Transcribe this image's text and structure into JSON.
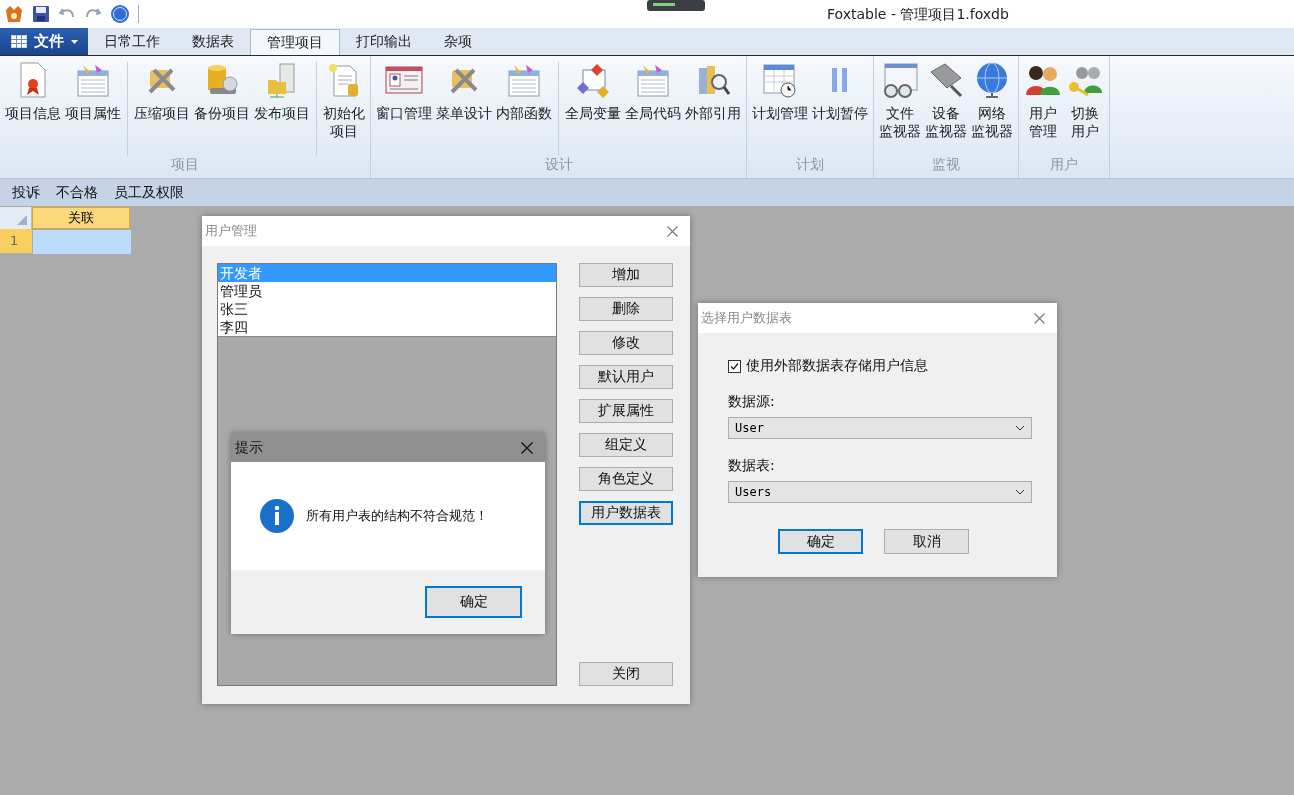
{
  "window": {
    "title": "Foxtable - 管理项目1.foxdb"
  },
  "file_button": {
    "label": "文件"
  },
  "ribbon_tabs": [
    {
      "label": "日常工作",
      "selected": false
    },
    {
      "label": "数据表",
      "selected": false
    },
    {
      "label": "管理项目",
      "selected": true
    },
    {
      "label": "打印输出",
      "selected": false
    },
    {
      "label": "杂项",
      "selected": false
    }
  ],
  "ribbon_groups": [
    {
      "label": "项目",
      "items": [
        {
          "lines": [
            "项目信息"
          ],
          "divider_before": false
        },
        {
          "lines": [
            "项目属性"
          ],
          "divider_before": false
        },
        {
          "lines": [
            "压缩项目"
          ],
          "divider_before": true
        },
        {
          "lines": [
            "备份项目"
          ],
          "divider_before": false
        },
        {
          "lines": [
            "发布项目"
          ],
          "divider_before": false
        },
        {
          "lines": [
            "初始化",
            "项目"
          ],
          "divider_before": true
        }
      ]
    },
    {
      "label": "设计",
      "items": [
        {
          "lines": [
            "窗口管理"
          ],
          "divider_before": false
        },
        {
          "lines": [
            "菜单设计"
          ],
          "divider_before": false
        },
        {
          "lines": [
            "内部函数"
          ],
          "divider_before": false
        },
        {
          "lines": [
            "全局变量"
          ],
          "divider_before": true
        },
        {
          "lines": [
            "全局代码"
          ],
          "divider_before": false
        },
        {
          "lines": [
            "外部引用"
          ],
          "divider_before": false
        }
      ]
    },
    {
      "label": "计划",
      "items": [
        {
          "lines": [
            "计划管理"
          ],
          "divider_before": false
        },
        {
          "lines": [
            "计划暂停"
          ],
          "divider_before": false
        }
      ]
    },
    {
      "label": "监视",
      "items": [
        {
          "lines": [
            "文件",
            "监视器"
          ],
          "divider_before": false
        },
        {
          "lines": [
            "设备",
            "监视器"
          ],
          "divider_before": false
        },
        {
          "lines": [
            "网络",
            "监视器"
          ],
          "divider_before": false
        }
      ]
    },
    {
      "label": "用户",
      "items": [
        {
          "lines": [
            "用户",
            "管理"
          ],
          "divider_before": false
        },
        {
          "lines": [
            "切换",
            "用户"
          ],
          "divider_before": false
        }
      ]
    }
  ],
  "sheet_tabs": [
    {
      "label": "投诉"
    },
    {
      "label": "不合格"
    },
    {
      "label": "员工及权限"
    }
  ],
  "grid": {
    "columns": [
      "关联"
    ],
    "rows": [
      "1"
    ]
  },
  "user_dialog": {
    "title": "用户管理",
    "users": [
      {
        "label": "开发者",
        "selected": true
      },
      {
        "label": "管理员",
        "selected": false
      },
      {
        "label": "张三",
        "selected": false
      },
      {
        "label": "李四",
        "selected": false
      }
    ],
    "buttons": [
      {
        "label": "增加",
        "focused": false
      },
      {
        "label": "删除",
        "focused": false
      },
      {
        "label": "修改",
        "focused": false
      },
      {
        "label": "默认用户",
        "focused": false
      },
      {
        "label": "扩展属性",
        "focused": false
      },
      {
        "label": "组定义",
        "focused": false
      },
      {
        "label": "角色定义",
        "focused": false
      },
      {
        "label": "用户数据表",
        "focused": true
      }
    ],
    "close_button": "关闭"
  },
  "message_dialog": {
    "title": "提示",
    "message": "所有用户表的结构不符合规范！",
    "ok": "确定"
  },
  "table_dialog": {
    "title": "选择用户数据表",
    "checkbox": {
      "label": "使用外部数据表存储用户信息",
      "checked": true
    },
    "source_label": "数据源:",
    "source_value": "User",
    "table_label": "数据表:",
    "table_value": "Users",
    "ok": "确定",
    "cancel": "取消"
  }
}
